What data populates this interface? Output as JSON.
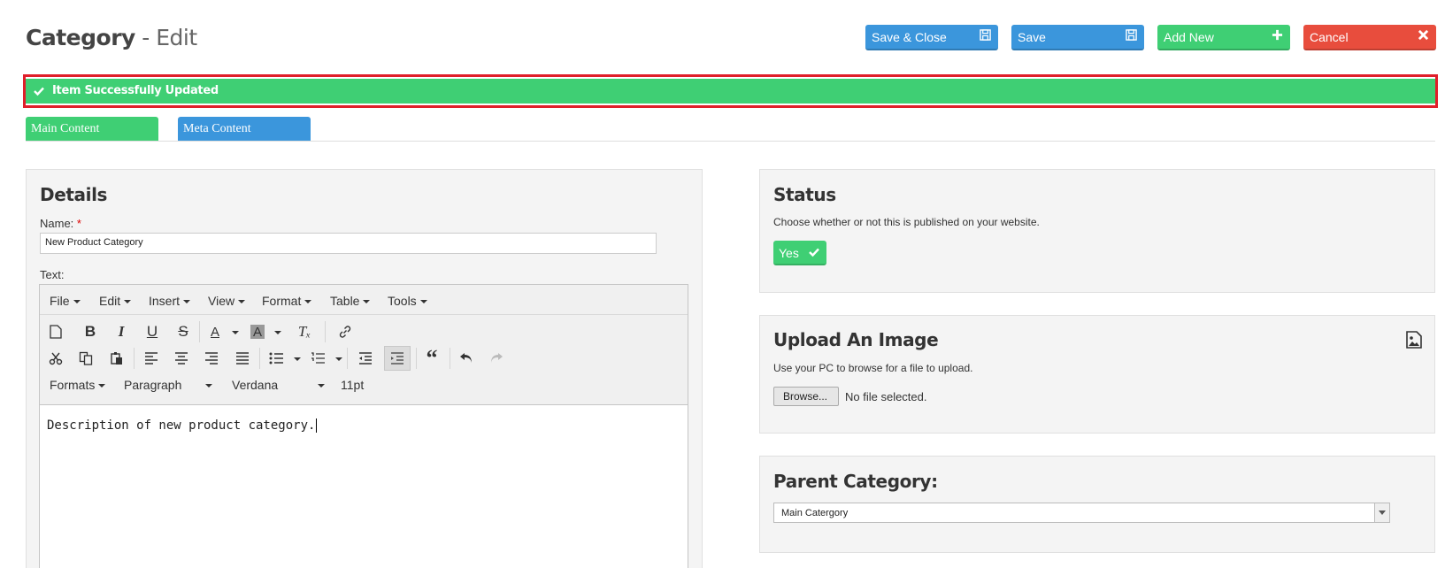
{
  "header": {
    "title_main": "Category",
    "title_sub": "- Edit"
  },
  "toolbar": {
    "save_close_label": "Save & Close",
    "save_label": "Save",
    "add_new_label": "Add New",
    "cancel_label": "Cancel"
  },
  "alert": {
    "message": "Item Successfully Updated"
  },
  "tabs": [
    {
      "label": "Main Content"
    },
    {
      "label": "Meta Content"
    }
  ],
  "details": {
    "heading": "Details",
    "name_label": "Name:",
    "name_required": "*",
    "name_value": "New Product Category",
    "text_label": "Text:"
  },
  "editor": {
    "menus": [
      "File",
      "Edit",
      "Insert",
      "View",
      "Format",
      "Table",
      "Tools"
    ],
    "formats_label": "Formats",
    "block_format": "Paragraph",
    "font_family": "Verdana",
    "font_size": "11pt",
    "content": "Description of new product category."
  },
  "status": {
    "heading": "Status",
    "description": "Choose whether or not this is published on your website.",
    "toggle_label": "Yes"
  },
  "upload": {
    "heading": "Upload An Image",
    "description": "Use your PC to browse for a file to upload.",
    "browse_label": "Browse...",
    "file_status": "No file selected."
  },
  "parent": {
    "heading": "Parent Category:",
    "selected": "Main Catergory"
  },
  "colors": {
    "blue": "#3b96dc",
    "green": "#3fcf74",
    "red": "#e84d3d",
    "highlight": "#e01e2a"
  },
  "icons": [
    "floppy-disk-icon",
    "plus-icon",
    "close-icon",
    "check-icon",
    "image-icon"
  ]
}
